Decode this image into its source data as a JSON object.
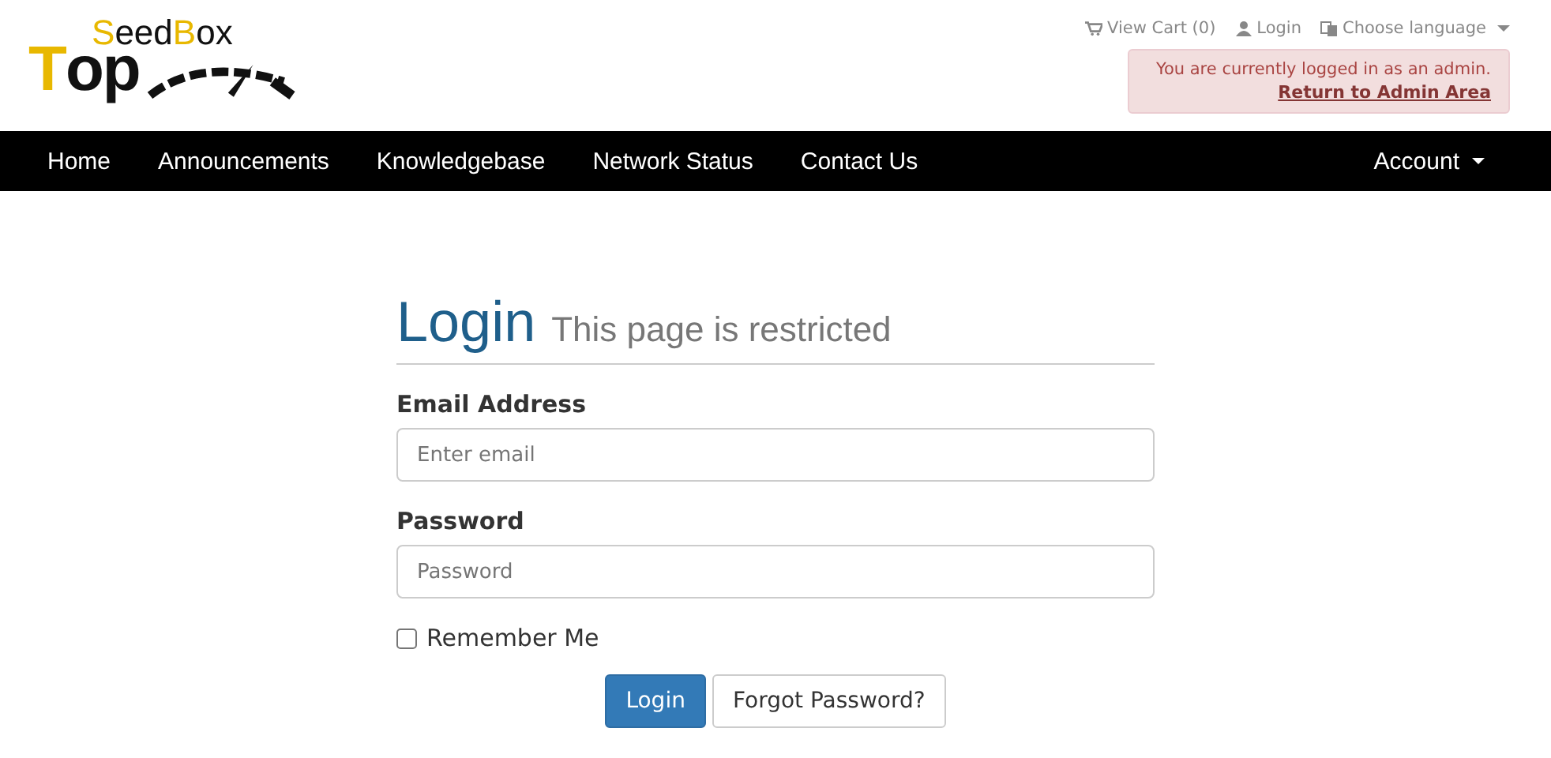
{
  "logo": {
    "upper": [
      {
        "text": "S",
        "highlight": true
      },
      {
        "text": "eed",
        "highlight": false
      },
      {
        "text": "B",
        "highlight": true
      },
      {
        "text": "ox",
        "highlight": false
      }
    ],
    "lower": [
      {
        "text": "T",
        "highlight": true
      },
      {
        "text": "op",
        "highlight": false
      }
    ]
  },
  "top_links": [
    {
      "label": "View Cart (0)",
      "kind": "cart",
      "dropdown": false
    },
    {
      "label": "Login",
      "kind": "user",
      "dropdown": false
    },
    {
      "label": "Choose language",
      "kind": "language",
      "dropdown": true
    }
  ],
  "admin_alert": {
    "message": "You are currently logged in as an admin.",
    "link": "Return to Admin Area"
  },
  "nav": {
    "items": [
      {
        "label": "Home"
      },
      {
        "label": "Announcements"
      },
      {
        "label": "Knowledgebase"
      },
      {
        "label": "Network Status"
      },
      {
        "label": "Contact Us"
      }
    ],
    "account": {
      "label": "Account",
      "dropdown": true
    }
  },
  "login": {
    "title": "Login",
    "subtitle": "This page is restricted",
    "fields": [
      {
        "label": "Email Address",
        "placeholder": "Enter email"
      },
      {
        "label": "Password",
        "placeholder": "Password"
      }
    ],
    "remember": {
      "label": "Remember Me",
      "checked": false
    },
    "buttons": [
      {
        "label": "Login",
        "kind": "primary"
      },
      {
        "label": "Forgot Password?",
        "kind": "default"
      }
    ]
  }
}
